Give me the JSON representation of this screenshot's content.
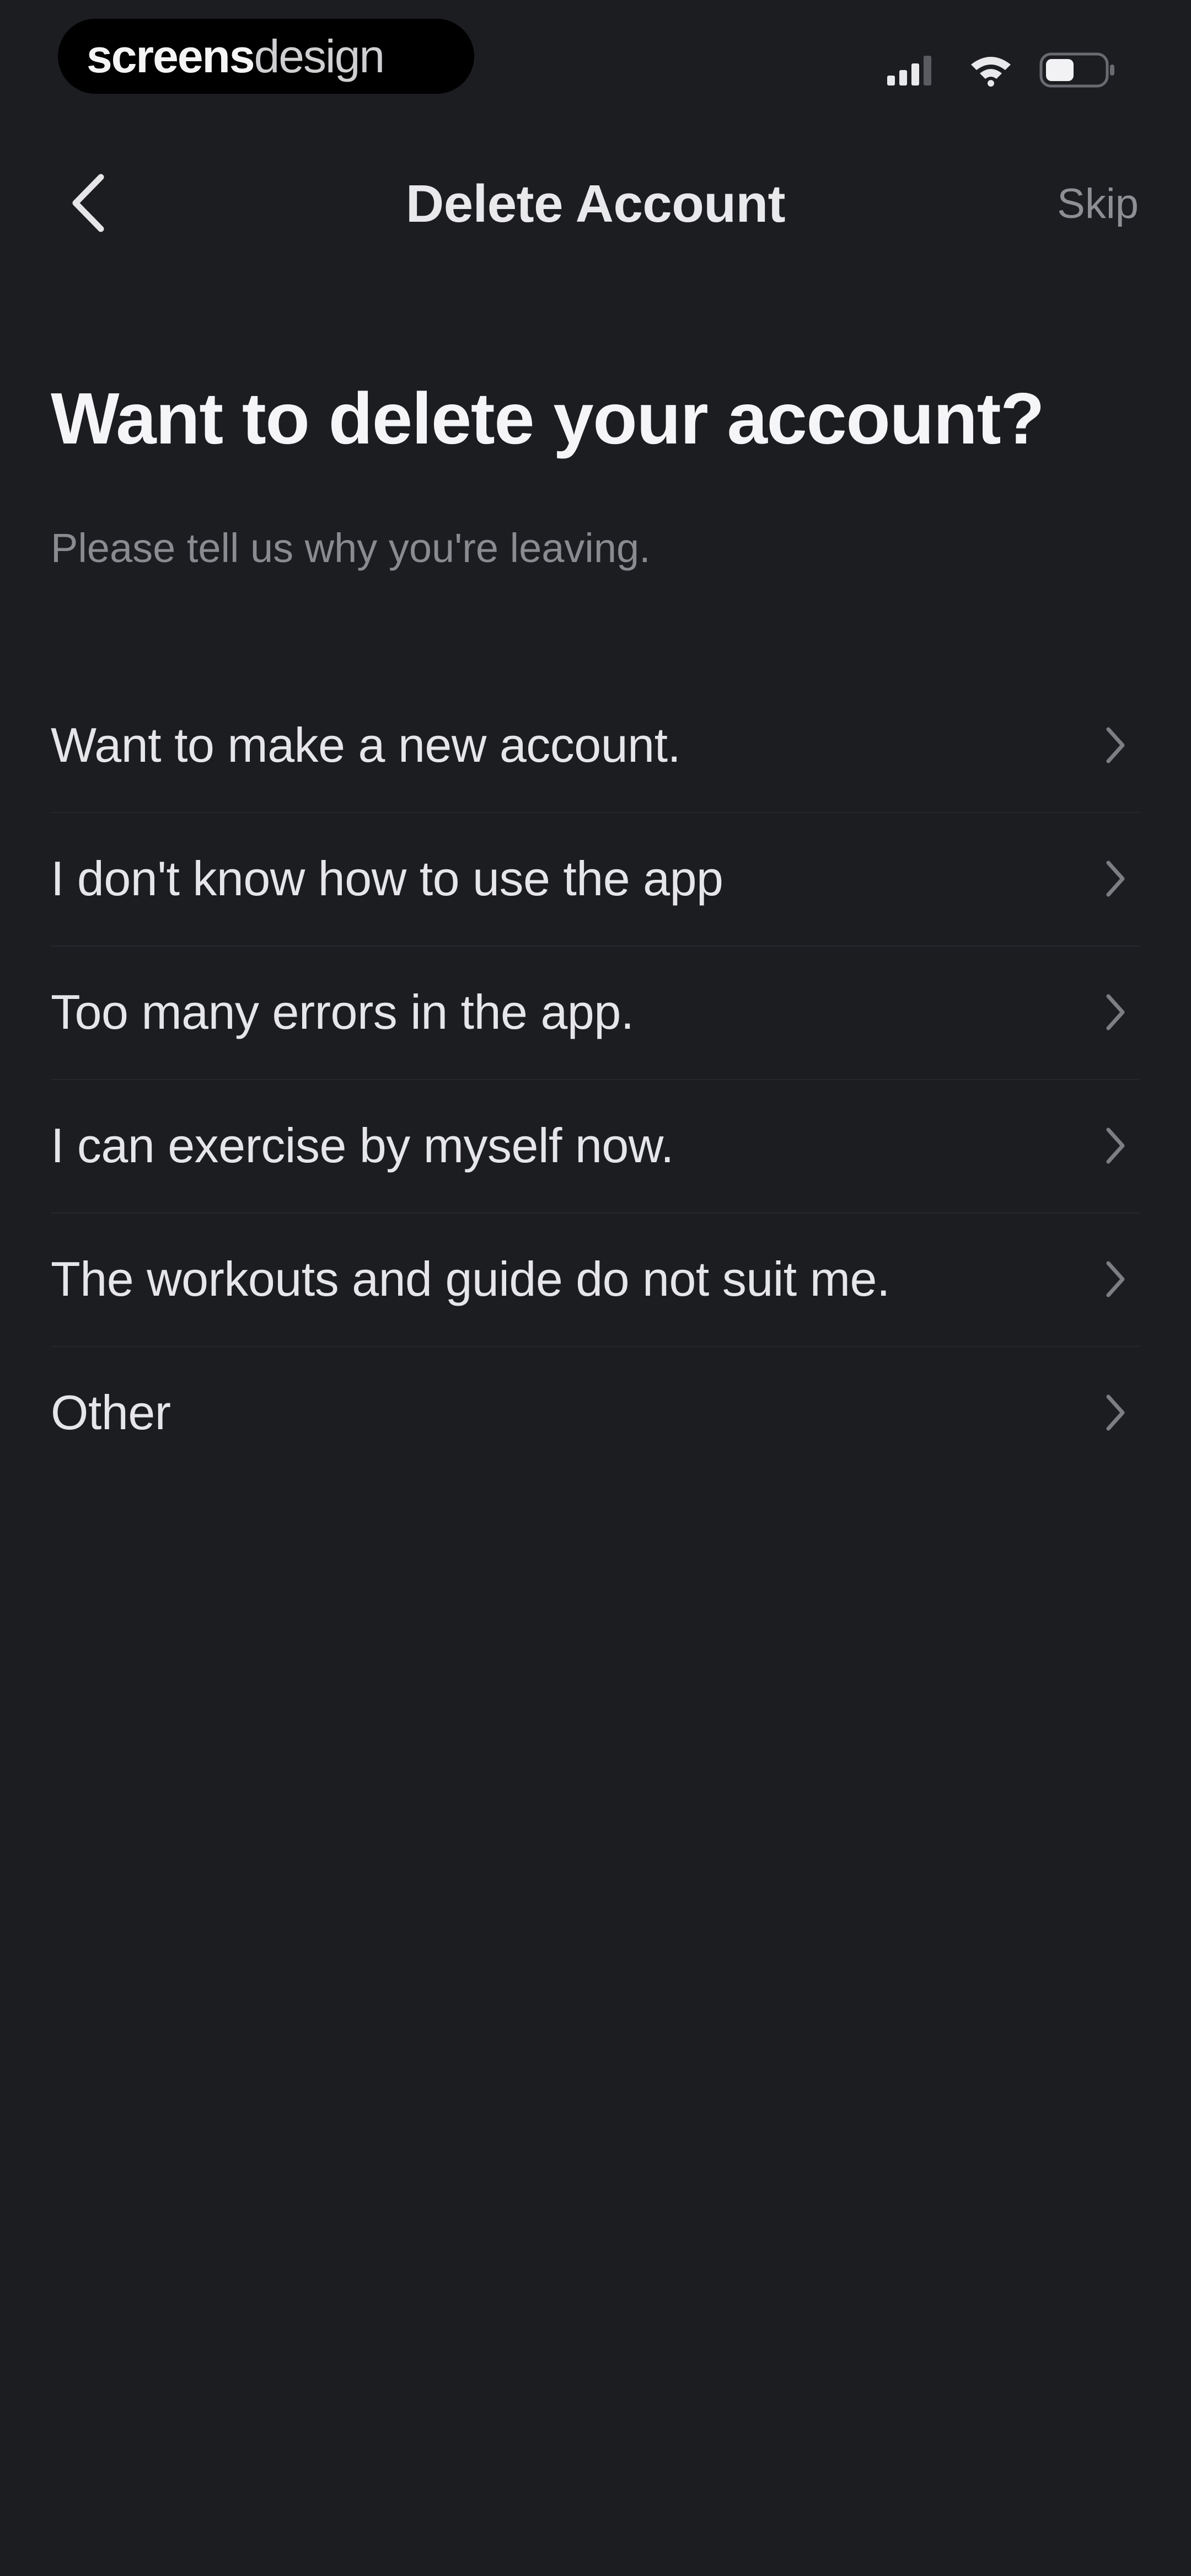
{
  "status_bar": {
    "brand": {
      "strong": "screens",
      "light": "design"
    },
    "icons": [
      "cellular-signal-icon",
      "wifi-icon",
      "battery-icon"
    ]
  },
  "nav": {
    "back_icon": "chevron-left-icon",
    "title": "Delete Account",
    "skip_label": "Skip"
  },
  "main": {
    "title": "Want to delete your account?",
    "subtitle": "Please tell us why you're leaving.",
    "reasons": [
      {
        "label": "Want to make a new account."
      },
      {
        "label": "I don't know how to use the app"
      },
      {
        "label": "Too many errors in the app."
      },
      {
        "label": "I can exercise by myself now."
      },
      {
        "label": "The workouts and guide do not suit me."
      },
      {
        "label": "Other"
      }
    ],
    "row_icon": "chevron-right-icon"
  },
  "colors": {
    "background": "#1c1d21",
    "primary_text": "#f2f2f4",
    "secondary_text": "#8a8b90",
    "divider": "#26272c"
  }
}
